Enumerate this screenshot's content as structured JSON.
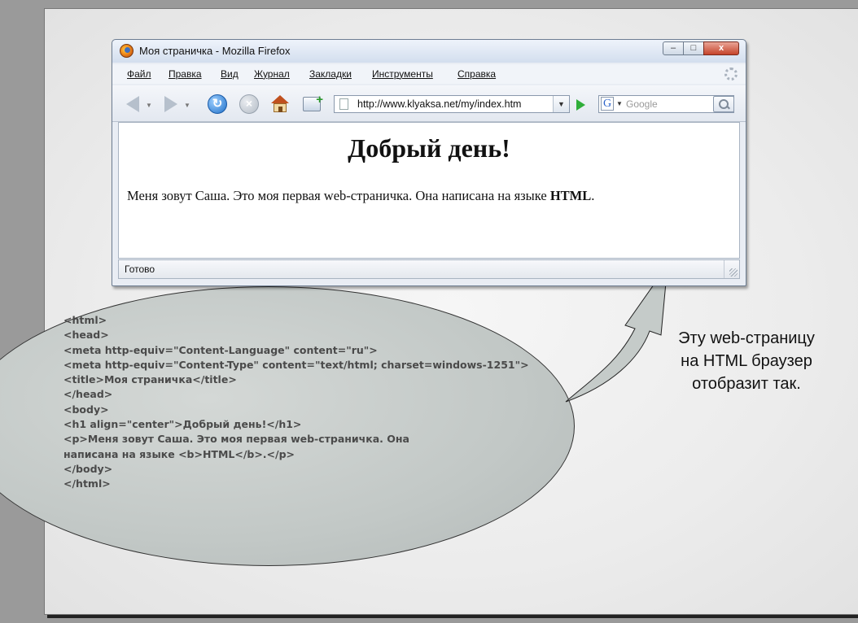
{
  "browser": {
    "window_title": "Моя страничка - Mozilla Firefox",
    "window_buttons": {
      "minimize": "–",
      "maximize": "□",
      "close": "x"
    },
    "menu": [
      "Файл",
      "Правка",
      "Вид",
      "Журнал",
      "Закладки",
      "Инструменты",
      "Справка"
    ],
    "url": "http://www.klyaksa.net/my/index.htm",
    "search_engine_letter": "G",
    "search_placeholder": "Google",
    "icons": [
      "back-icon",
      "forward-icon",
      "reload-icon",
      "stop-icon",
      "home-icon",
      "bookmark-add-icon",
      "go-icon",
      "search-icon",
      "throbber-icon"
    ],
    "page": {
      "heading": "Добрый день!",
      "paragraph_text": "Меня зовут Саша. Это моя первая web-страничка. Она написана на языке ",
      "paragraph_bold": "HTML",
      "paragraph_end": "."
    },
    "status": "Готово"
  },
  "code_lines": [
    "<html>",
    "<head>",
    "<meta http-equiv=\"Content-Language\" content=\"ru\">",
    "<meta http-equiv=\"Content-Type\" content=\"text/html; charset=windows-1251\">",
    "<title>Моя страничка</title>",
    "</head>",
    "<body>",
    "<h1 align=\"center\">Добрый день!</h1>",
    "<p>Меня зовут Саша. Это моя первая web-страничка. Она",
    "написана на языке <b>HTML</b>.</p>",
    "</body>",
    "</html>"
  ],
  "caption": "Эту web-страницу\nна HTML браузер\nотобразит так.",
  "colors": {
    "bubble_fill": "#c2c8c6",
    "code_text": "#4a4a4a",
    "slide_background": "#ececec",
    "frame_background": "#9a9a9a"
  }
}
